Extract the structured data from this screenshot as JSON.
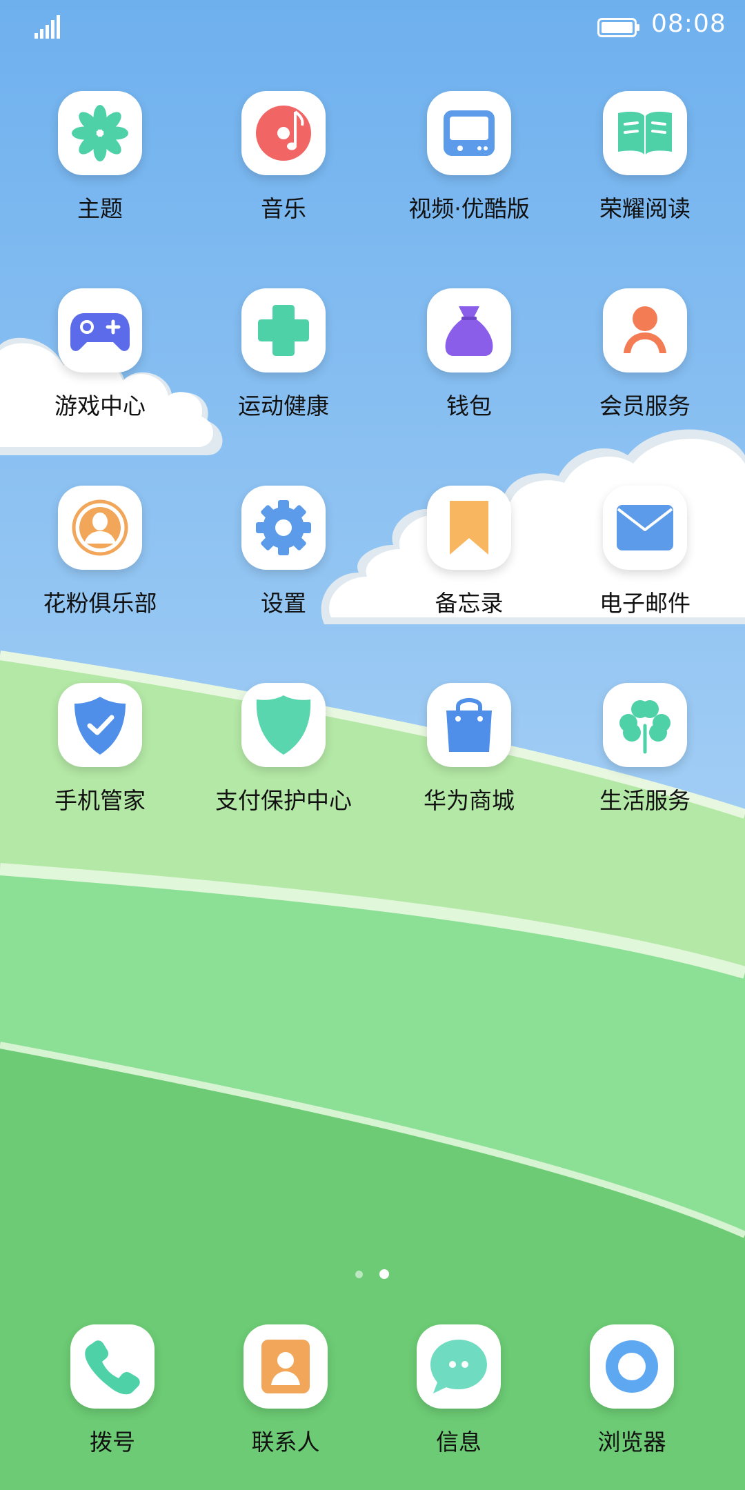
{
  "status_bar": {
    "time": "08:08"
  },
  "apps": [
    {
      "label": "主题",
      "icon": "theme-icon"
    },
    {
      "label": "音乐",
      "icon": "music-icon"
    },
    {
      "label": "视频·优酷版",
      "icon": "video-icon"
    },
    {
      "label": "荣耀阅读",
      "icon": "book-icon"
    },
    {
      "label": "游戏中心",
      "icon": "gamepad-icon"
    },
    {
      "label": "运动健康",
      "icon": "health-cross-icon"
    },
    {
      "label": "钱包",
      "icon": "wallet-bag-icon"
    },
    {
      "label": "会员服务",
      "icon": "member-icon"
    },
    {
      "label": "花粉俱乐部",
      "icon": "club-user-icon"
    },
    {
      "label": "设置",
      "icon": "gear-icon"
    },
    {
      "label": "备忘录",
      "icon": "bookmark-icon"
    },
    {
      "label": "电子邮件",
      "icon": "mail-icon"
    },
    {
      "label": "手机管家",
      "icon": "shield-check-icon"
    },
    {
      "label": "支付保护中心",
      "icon": "shield-icon"
    },
    {
      "label": "华为商城",
      "icon": "shopping-bag-icon"
    },
    {
      "label": "生活服务",
      "icon": "clover-icon"
    }
  ],
  "page_indicator": {
    "count": 2,
    "active": 1
  },
  "dock": [
    {
      "label": "拨号",
      "icon": "phone-icon"
    },
    {
      "label": "联系人",
      "icon": "contacts-icon"
    },
    {
      "label": "信息",
      "icon": "message-icon"
    },
    {
      "label": "浏览器",
      "icon": "browser-icon"
    }
  ],
  "colors": {
    "sky_top": "#6eb0ee",
    "sky_bottom": "#a6d0f5",
    "grass_light": "#b4e8a6",
    "grass_mid": "#8ce096",
    "grass_dark": "#6ccb74",
    "accent_teal": "#4fd1a8",
    "accent_blue": "#5b9bea",
    "accent_orange": "#f2a65a"
  }
}
